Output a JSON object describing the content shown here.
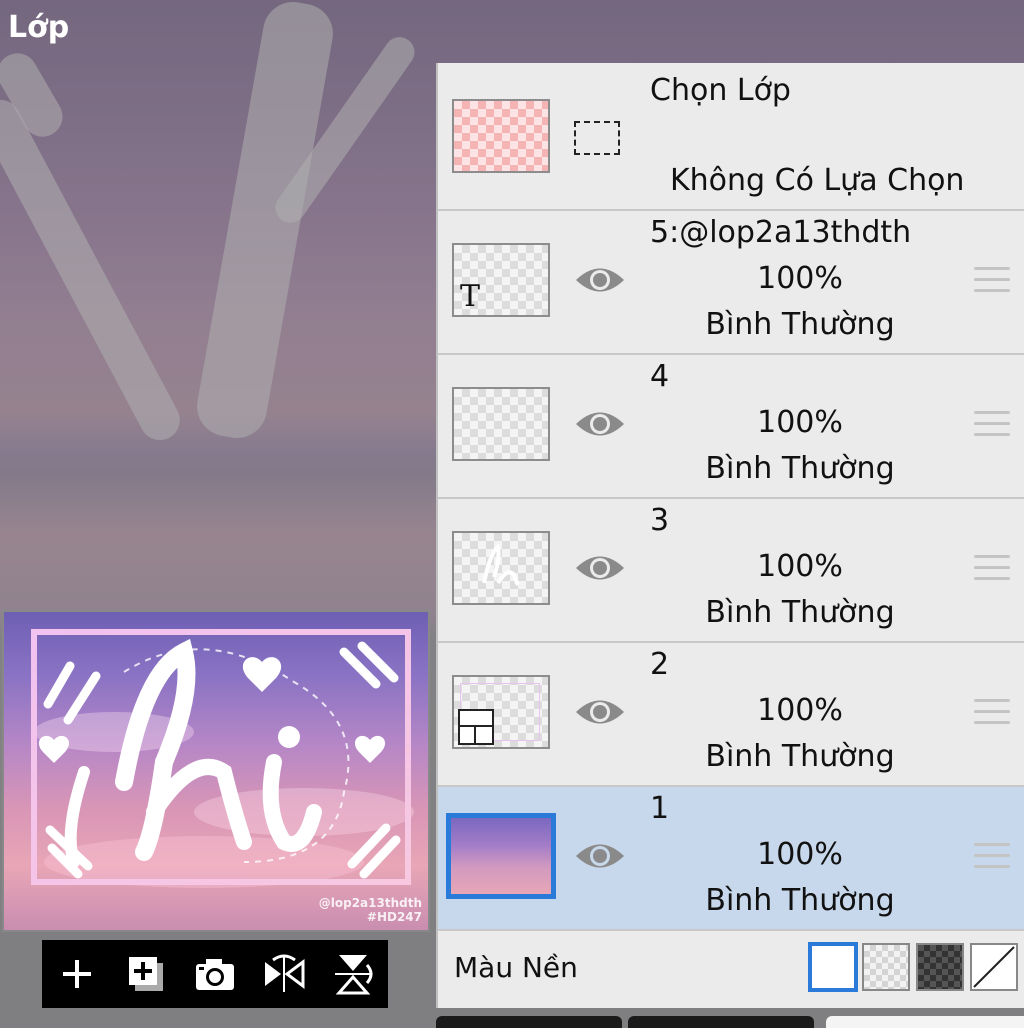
{
  "app": {
    "title": "Lớp"
  },
  "preview": {
    "watermark_line1": "@lop2a13thdth",
    "watermark_line2": "#HD247"
  },
  "toolbar": {
    "items": [
      "add-layer",
      "duplicate-layer",
      "camera",
      "flip-horizontal",
      "flip-vertical"
    ]
  },
  "selection": {
    "title": "Chọn Lớp",
    "status": "Không Có Lựa Chọn"
  },
  "layers": [
    {
      "name": "5:@lop2a13thdth",
      "opacity": "100%",
      "blend": "Bình Thường",
      "type": "text",
      "visible": true,
      "selected": false
    },
    {
      "name": "4",
      "opacity": "100%",
      "blend": "Bình Thường",
      "type": "raster",
      "visible": true,
      "selected": false
    },
    {
      "name": "3",
      "opacity": "100%",
      "blend": "Bình Thường",
      "type": "raster",
      "visible": true,
      "selected": false
    },
    {
      "name": "2",
      "opacity": "100%",
      "blend": "Bình Thường",
      "type": "frame",
      "visible": true,
      "selected": false
    },
    {
      "name": "1",
      "opacity": "100%",
      "blend": "Bình Thường",
      "type": "photo",
      "visible": true,
      "selected": true
    }
  ],
  "background_color": {
    "label": "Màu Nền",
    "options": [
      "white",
      "light-checker",
      "dark-checker",
      "none"
    ],
    "selected": "white"
  },
  "colors": {
    "accent": "#2a7bd9",
    "selected_row": "#c8d8ec",
    "row": "#ebebeb"
  }
}
